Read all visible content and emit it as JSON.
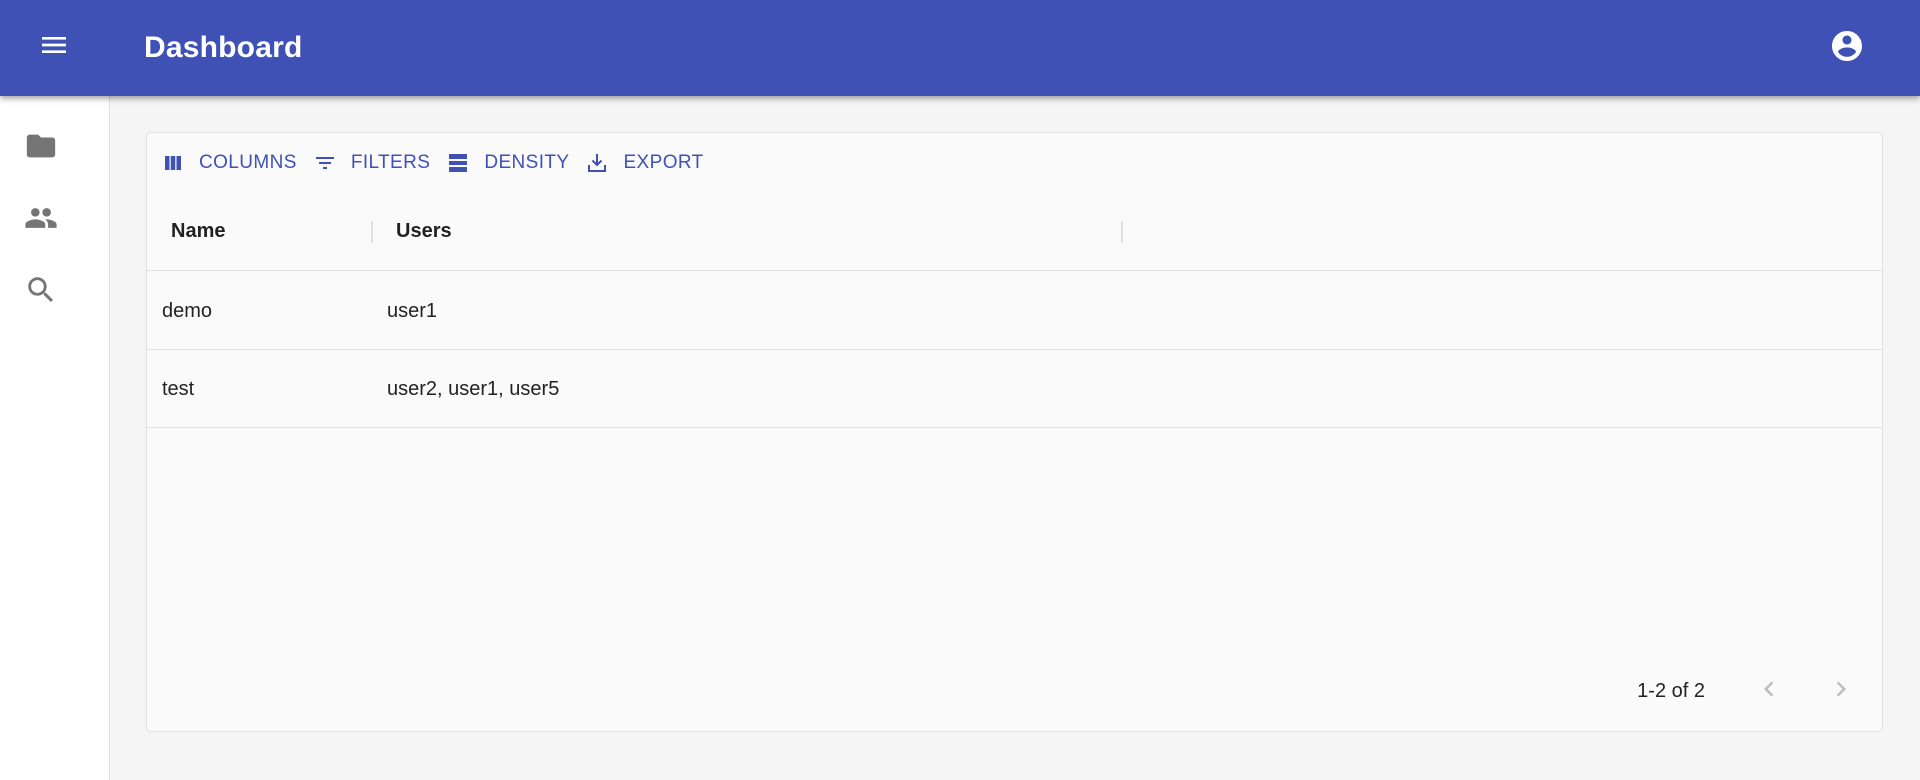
{
  "appbar": {
    "title": "Dashboard",
    "background": "#3f51b5",
    "menu_icon": "menu-icon",
    "account_icon": "account-circle-icon"
  },
  "drawer": {
    "items": [
      {
        "icon": "folder-icon"
      },
      {
        "icon": "people-icon"
      },
      {
        "icon": "search-icon"
      }
    ]
  },
  "toolbar": {
    "columns_label": "COLUMNS",
    "filters_label": "FILTERS",
    "density_label": "DENSITY",
    "export_label": "EXPORT"
  },
  "table": {
    "columns": [
      "Name",
      "Users"
    ],
    "rows": [
      {
        "name": "demo",
        "users": "user1"
      },
      {
        "name": "test",
        "users": "user2, user1, user5"
      }
    ]
  },
  "pagination": {
    "range_text": "1-2 of 2",
    "prev_icon": "chevron-left-icon",
    "next_icon": "chevron-right-icon"
  },
  "colors": {
    "accent": "#3f51b5",
    "icon_gray": "#757575"
  }
}
